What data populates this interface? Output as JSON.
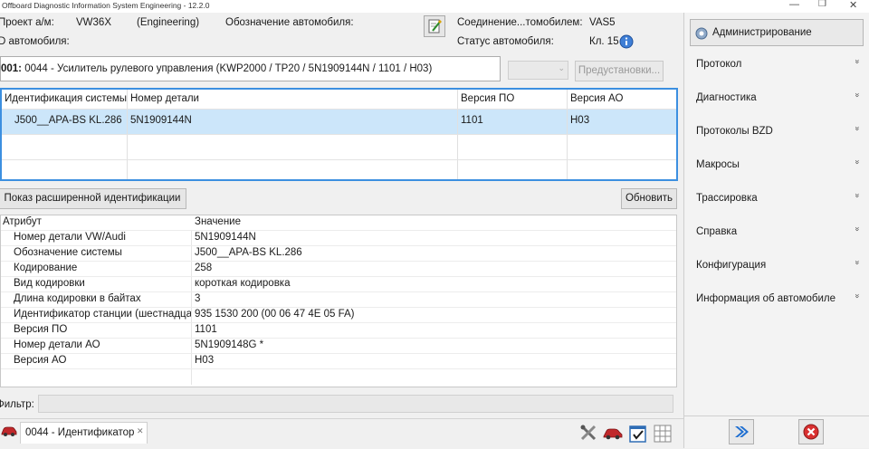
{
  "window": {
    "title": "Offboard Diagnostic Information System Engineering - 12.2.0",
    "minimize": "—",
    "restore": "❐",
    "close": "✕"
  },
  "header": {
    "project_label": "Проект а/м:",
    "project_value": "VW36X",
    "mode": "(Engineering)",
    "vehicle_designation_label": "Обозначение автомобиля:",
    "vehicle_id_label": "D автомобиля:",
    "connection_label": "Соединение...томобилем:",
    "connection_value": "VAS5",
    "status_label": "Статус автомобиля:",
    "status_value": "Кл. 15"
  },
  "ecu": {
    "title": "001: 0044 - Усилитель рулевого управления  (KWP2000 / TP20 / 5N1909144N / 1101 / H03)",
    "title_bold": "001:",
    "title_rest": " 0044 - Усилитель рулевого управления  (KWP2000 / TP20 / 5N1909144N / 1101 / H03)",
    "presets_label": "Предустановки...",
    "combo_arrow": "⌄"
  },
  "system_table": {
    "headers": [
      "Идентификация системы",
      "Номер детали",
      "Версия ПО",
      "Версия АО"
    ],
    "rows": [
      [
        "J500__APA-BS KL.286",
        "5N1909144N",
        "1101",
        "H03"
      ]
    ]
  },
  "buttons": {
    "extended_id": "Показ расширенной идентификации",
    "refresh": "Обновить"
  },
  "attr_table": {
    "header_attr": "Атрибут",
    "header_value": "Значение",
    "rows": [
      {
        "attr": "Номер детали VW/Audi",
        "value": "5N1909144N"
      },
      {
        "attr": "Обозначение системы",
        "value": "J500__APA-BS KL.286"
      },
      {
        "attr": "Кодирование",
        "value": "258"
      },
      {
        "attr": "Вид кодировки",
        "value": "короткая кодировка"
      },
      {
        "attr": "Длина кодировки в байтах",
        "value": "3"
      },
      {
        "attr": "Идентификатор станции (шестнадцатеричный)",
        "value": "935 1530 200 (00 06 47 4E 05 FA)"
      },
      {
        "attr": "Версия ПО",
        "value": "1101"
      },
      {
        "attr": "Номер детали АО",
        "value": "5N1909148G  *"
      },
      {
        "attr": "Версия АО",
        "value": "H03"
      }
    ]
  },
  "filter": {
    "label": "Фильтр:",
    "value": ""
  },
  "bottom_tab": {
    "label": "0044 - Идентификатор",
    "close_glyph": "✕"
  },
  "right_panel": {
    "admin_label": "Администрирование",
    "menu": [
      {
        "label": "Протокол"
      },
      {
        "label": "Диагностика"
      },
      {
        "label": "Протоколы BZD"
      },
      {
        "label": "Макросы"
      },
      {
        "label": "Трассировка"
      },
      {
        "label": "Справка"
      },
      {
        "label": "Конфигурация"
      },
      {
        "label": "Информация об автомобиле"
      }
    ],
    "chevron": "»"
  },
  "icons": {
    "edit": "edit-document-icon",
    "info": "info-icon",
    "car": "car-icon",
    "forward": "forward-icon",
    "cancel": "cancel-icon"
  },
  "colors": {
    "selection": "#cce6fa",
    "grid_focus_border": "#3c8fe0",
    "forward_icon": "#1f6fd1",
    "cancel_icon": "#d93030"
  }
}
